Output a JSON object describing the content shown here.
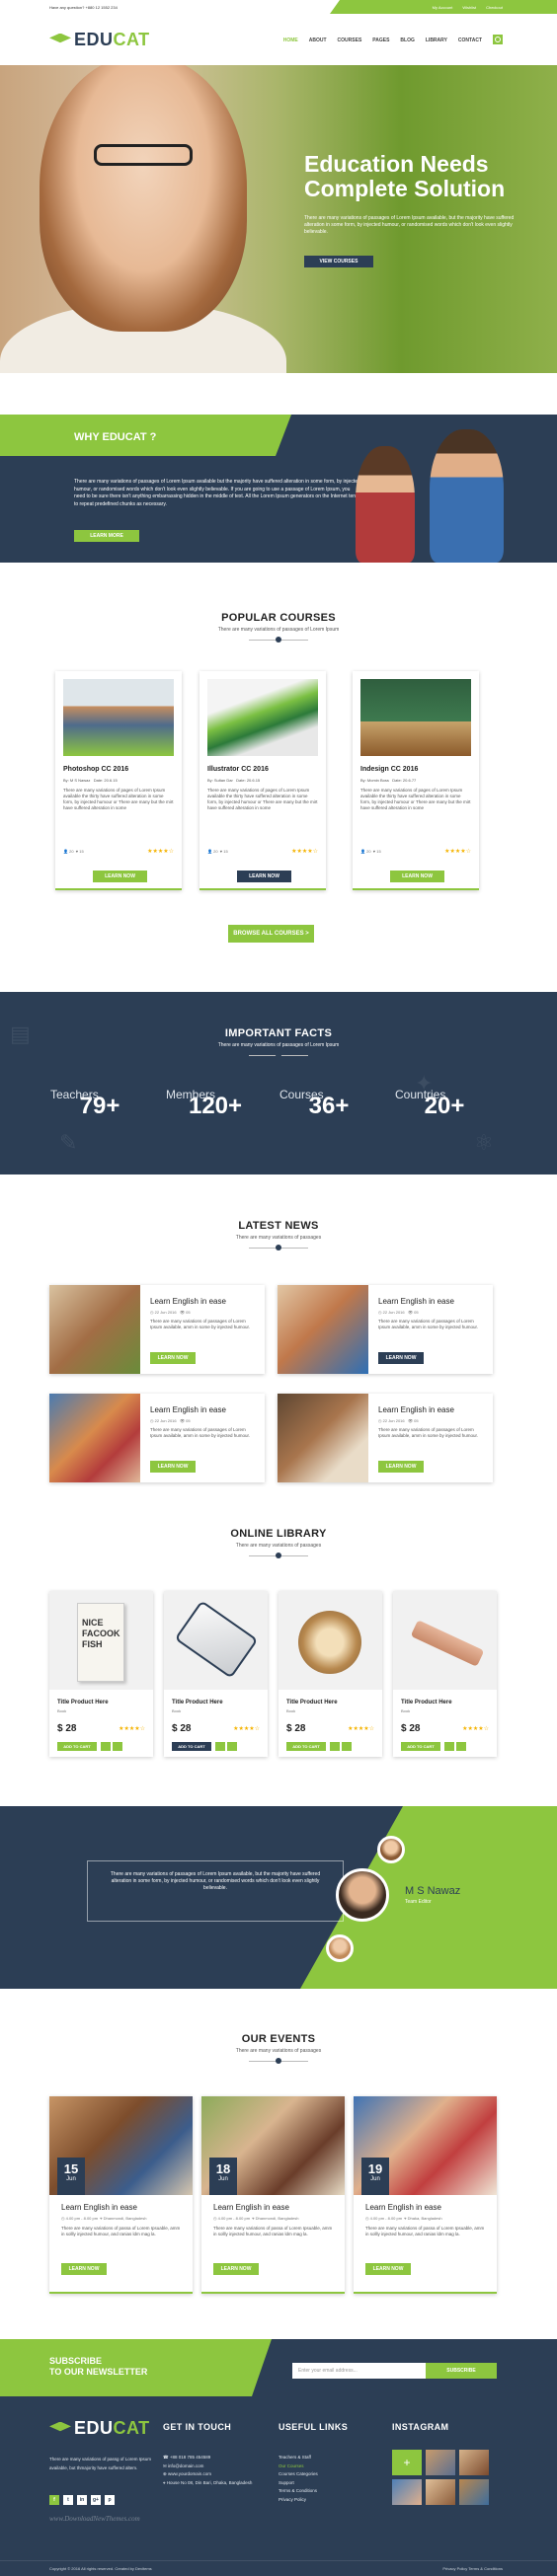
{
  "colors": {
    "brand": "#8dc63f",
    "navy": "#2c3e55",
    "star": "#f5b301"
  },
  "topbar": {
    "question": "Have any question? +880 12 1552 234",
    "links": [
      "My Account",
      "Wishlist",
      "Checkout"
    ]
  },
  "header": {
    "logo": "EDUCAT",
    "nav": [
      "HOME",
      "ABOUT",
      "COURSES",
      "PAGES",
      "BLOG",
      "LIBRARY",
      "CONTACT"
    ],
    "search_icon": "search-icon"
  },
  "hero": {
    "title1": "Education Needs",
    "title2": "Complete Solution",
    "text": "There are many variations of passages of Lorem Ipsum available, but the majority have suffered alteration in some form, by injected humour, or randomised words which don't look even slightly believable.",
    "button": "VIEW COURSES"
  },
  "why": {
    "title": "WHY EDUCAT ?",
    "text": "There are many variations of passages of Lorem Ipsum available but the majority have suffered alteration in some form, by injected humour, or randomised words which don't look even slightly believable. If you are going to use a passage of Lorem Ipsum, you need to be sure there isn't anything embarrassing hidden in the middle of text. All the Lorem Ipsum generators on the Internet tend to repeat predefined chunks as necessary.",
    "button": "LEARN MORE"
  },
  "courses": {
    "title": "POPULAR COURSES",
    "subtitle": "There are many variations of passages of Lorem Ipsum",
    "items": [
      {
        "title": "Photoshop CC 2016",
        "by": "By: M S Nawaz",
        "date": "Date: 20.6.15",
        "desc": "There are many variations of pages of Lorem Ipsum available the thirty have suffered alteration in some form, by injected humour or There are many but the mirt have suffered alteration in some",
        "students": "20",
        "likes": "15",
        "button": "LEARN NOW",
        "stars": "★★★★☆"
      },
      {
        "title": "Illustrator CC 2016",
        "by": "By: Sultan Dar",
        "date": "Date: 20.6.15",
        "desc": "There are many variations of pages of Lorem Ipsum available the thirty have suffered alteration in some form, by injected humour or There are many but the mirt have suffered alteration in some",
        "students": "20",
        "likes": "15",
        "button": "LEARN NOW",
        "stars": "★★★★☆"
      },
      {
        "title": "Indesign CC 2016",
        "by": "By: Momin Boss",
        "date": "Date: 20.6.77",
        "desc": "There are many variations of pages of Lorem Ipsum available the thirty have suffered alteration in some form, by injected humour or There are many but the mirt have suffered alteration in some",
        "students": "20",
        "likes": "15",
        "button": "LEARN NOW",
        "stars": "★★★★☆"
      }
    ],
    "browse": "Browse All Courses  >"
  },
  "facts": {
    "title": "IMPORTANT FACTS",
    "subtitle": "There are many variations of passages of Lorem Ipsum",
    "items": [
      {
        "label": "Teachers",
        "value": "79+"
      },
      {
        "label": "Members",
        "value": "120+"
      },
      {
        "label": "Courses",
        "value": "36+"
      },
      {
        "label": "Countries",
        "value": "20+"
      }
    ]
  },
  "news": {
    "title": "LATEST NEWS",
    "subtitle": "There are many variations of passages",
    "items": [
      {
        "title": "Learn English in ease",
        "date": "22 Jun 2016",
        "views": "05",
        "text": "There are many variations of passages of Lorem Ipsum available, amm in some by injected humour.",
        "button": "LEARN NOW"
      },
      {
        "title": "Learn English in ease",
        "date": "22 Jun 2016",
        "views": "05",
        "text": "There are many variations of passages of Lorem Ipsum available, amm in some by injected humour.",
        "button": "LEARN NOW"
      },
      {
        "title": "Learn English in ease",
        "date": "22 Jun 2016",
        "views": "05",
        "text": "There are many variations of passages of Lorem Ipsum available, amm in some by injected humour.",
        "button": "LEARN NOW"
      },
      {
        "title": "Learn English in ease",
        "date": "22 Jun 2016",
        "views": "05",
        "text": "There are many variations of passages of Lorem Ipsum available, amm in some by injected humour.",
        "button": "LEARN NOW"
      }
    ]
  },
  "library": {
    "title": "ONLINE LIBRARY",
    "subtitle": "There are many variations of passages",
    "items": [
      {
        "title": "Title Product Here",
        "cat": "Book",
        "price": "$ 28",
        "button": "ADD TO CART",
        "stars": "★★★★☆",
        "cover": "NICE FACOOK FISH"
      },
      {
        "title": "Title Product Here",
        "cat": "Book",
        "price": "$ 28",
        "button": "ADD TO CART",
        "stars": "★★★★☆"
      },
      {
        "title": "Title Product Here",
        "cat": "Book",
        "price": "$ 28",
        "button": "ADD TO CART",
        "stars": "★★★★☆"
      },
      {
        "title": "Title Product Here",
        "cat": "Book",
        "price": "$ 28",
        "button": "ADD TO CART",
        "stars": "★★★★☆"
      }
    ]
  },
  "testimonial": {
    "text": "There are many variations of passages of Lorem Ipsum available, but the majority have suffered alteration in some form, by injected humour, or randomised words which don't look even slightly believable.",
    "name": "M S Nawaz",
    "position": "Team Editor"
  },
  "events": {
    "title": "OUR EVENTS",
    "subtitle": "There are many variations of passages",
    "items": [
      {
        "day": "15",
        "month": "Jun",
        "title": "Learn English in ease",
        "time": "4.00 pm - 8.00 pm",
        "place": "Dhanmondi, Bangladesh",
        "text": "There are many variations of passa of Lorem Ipsuable, amm in sollly injected humour, and ranias ldm mag la.",
        "button": "LEARN NOW"
      },
      {
        "day": "18",
        "month": "Jun",
        "title": "Learn English in ease",
        "time": "4.00 pm - 8.00 pm",
        "place": "Dhanmondi, Bangladesh",
        "text": "There are many variations of passa of Lorem Ipsuable, amm in sollly injected humour, and ranias ldm mag la.",
        "button": "LEARN NOW"
      },
      {
        "day": "19",
        "month": "Jun",
        "title": "Learn English in ease",
        "time": "4.00 pm - 8.00 pm",
        "place": "Dhaka, Bangladesh",
        "text": "There are many variations of passa of Lorem Ipsuable, amm in sollly injected humour, and ranias ldm mag la.",
        "button": "LEARN NOW"
      }
    ]
  },
  "newsletter": {
    "title1": "SUBSCRIBE",
    "title2": "TO OUR NEWSLETTER",
    "placeholder": "Enter your email address...",
    "button": "SUBSCRIBE"
  },
  "footer": {
    "logo": "EDUCAT",
    "about": "There are many variations of passg of Lorem Ipsum available, but thmajority have suffered altem.",
    "contact_title": "GET IN TOUCH",
    "contact": [
      "+88 018 785 454589",
      "info@domain.com",
      "www.yourdomain.com",
      "House No 08, Din Bari, Dhaka, Bangladesh"
    ],
    "links_title": "USEFUL LINKS",
    "links": [
      "Teachers & Staff",
      "Our Courses",
      "Courses Categories",
      "Support",
      "Terms & Conditions",
      "Privacy Policy"
    ],
    "insta_title": "INSTAGRAM",
    "copyright": "Copyright © 2016 All rights reserved. Created by Devitems",
    "bottom_links": "Privacy Policy   Terms & Conditions",
    "watermark": "www.DownloadNewThemes.com",
    "social": [
      "f",
      "t",
      "in",
      "g+",
      "p"
    ]
  }
}
